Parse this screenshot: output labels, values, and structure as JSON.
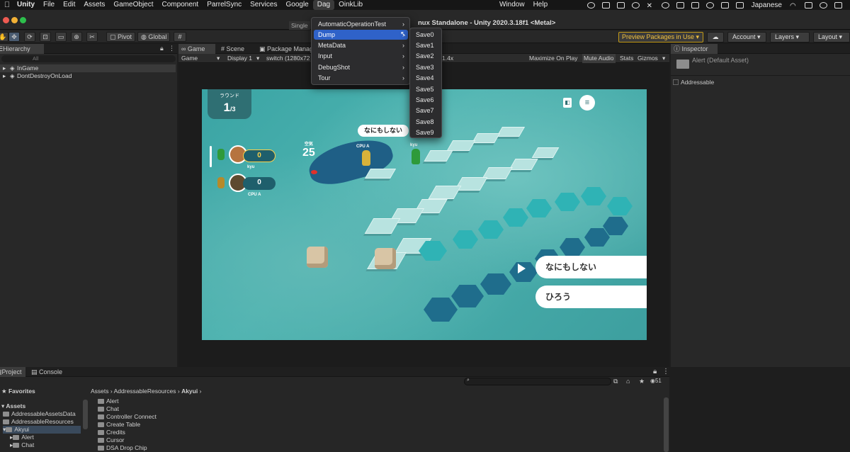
{
  "menubar": {
    "app": "Unity",
    "items": [
      "File",
      "Edit",
      "Assets",
      "GameObject",
      "Component",
      "ParrelSync",
      "Services",
      "Google",
      "Dag",
      "OinkLib",
      "Window",
      "Help"
    ],
    "active": "Dag",
    "language": "Japanese"
  },
  "window": {
    "title": "nux Standalone - Unity 2020.3.18f1 <Metal>",
    "single_label": "Single"
  },
  "toolbar": {
    "pivot": "Pivot",
    "global": "Global",
    "preview_packages": "Preview Packages in Use",
    "account": "Account",
    "layers": "Layers",
    "layout": "Layout"
  },
  "hierarchy": {
    "tab": "Hierarchy",
    "search_placeholder": "All",
    "rows": [
      "InGame",
      "DontDestroyOnLoad"
    ]
  },
  "game_tabs": {
    "game": "Game",
    "scene": "Scene",
    "package_manager": "Package Manag"
  },
  "game_toolbar": {
    "display": "Game",
    "display_num": "Display 1",
    "resolution": "switch (1280x72",
    "scale": "1.4x",
    "maximize": "Maximize On Play",
    "mute": "Mute Audio",
    "stats": "Stats",
    "gizmos": "Gizmos"
  },
  "dag_menu": {
    "items": [
      {
        "label": "AutomaticOperationTest",
        "submenu": true
      },
      {
        "label": "Dump",
        "submenu": true
      },
      {
        "label": "MetaData",
        "submenu": true
      },
      {
        "label": "Input",
        "submenu": true
      },
      {
        "label": "DebugShot",
        "submenu": true
      },
      {
        "label": "Tour",
        "submenu": true
      }
    ],
    "highlighted": "Dump",
    "submenu_items": [
      "Save0",
      "Save1",
      "Save2",
      "Save3",
      "Save4",
      "Save5",
      "Save6",
      "Save7",
      "Save8",
      "Save9"
    ]
  },
  "game": {
    "round_label": "ラウンド",
    "round_value": "1",
    "round_total": "/3",
    "remaining_label": "空気",
    "remaining_value": "25",
    "player1": {
      "name": "kyu",
      "score": "0"
    },
    "player2": {
      "name": "CPU A",
      "score": "0"
    },
    "boat_label": "CPU A",
    "pawn_label": "kyu",
    "bubble_text": "なにもしない",
    "choice1": "なにもしない",
    "choice2": "ひろう"
  },
  "inspector": {
    "tab": "Inspector",
    "asset": "Alert (Default Asset)",
    "addressable": "Addressable"
  },
  "bottom_tabs": {
    "project": "Project",
    "console": "Console"
  },
  "project": {
    "favorites": "Favorites",
    "assets": "Assets",
    "tree": [
      "AddressableAssetsData",
      "AddressableResources",
      "Akyui",
      "Alert",
      "Chat"
    ],
    "breadcrumb": [
      "Assets",
      "AddressableResources",
      "Akyui"
    ],
    "files": [
      "Alert",
      "Chat",
      "Controller Connect",
      "Create Table",
      "Credits",
      "Cursor",
      "DSA Drop Chip"
    ],
    "count": "51"
  },
  "colors": {
    "accent": "#2f62c9",
    "preview_border": "#c29a17",
    "game_bg": "#3aa4a4"
  }
}
